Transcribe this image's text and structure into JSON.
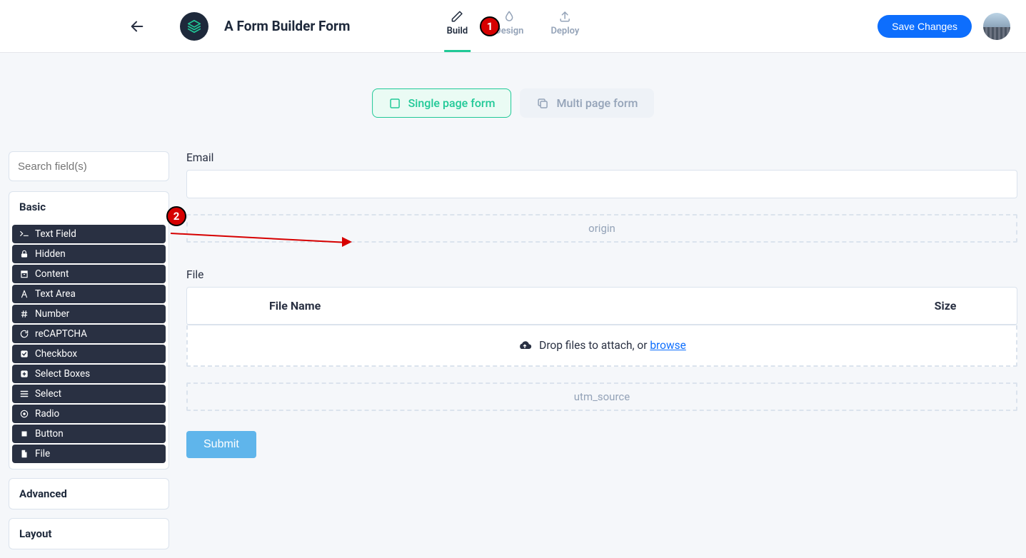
{
  "header": {
    "title": "A Form Builder Form",
    "tabs": {
      "build": "Build",
      "design": "Design",
      "deploy": "Deploy"
    },
    "save_label": "Save Changes"
  },
  "page_toggle": {
    "single": "Single page form",
    "multi": "Multi page form"
  },
  "sidebar": {
    "search_placeholder": "Search field(s)",
    "groups": {
      "basic": "Basic",
      "advanced": "Advanced",
      "layout": "Layout"
    },
    "basic_items": [
      "Text Field",
      "Hidden",
      "Content",
      "Text Area",
      "Number",
      "reCAPTCHA",
      "Checkbox",
      "Select Boxes",
      "Select",
      "Radio",
      "Button",
      "File"
    ]
  },
  "form": {
    "email_label": "Email",
    "origin_hidden": "origin",
    "file_label": "File",
    "table": {
      "name": "File Name",
      "size": "Size"
    },
    "dropzone_text": "Drop files to attach, or ",
    "dropzone_link": "browse",
    "utm_hidden": "utm_source",
    "submit_label": "Submit"
  },
  "annotations": {
    "marker1": "1",
    "marker2": "2"
  }
}
